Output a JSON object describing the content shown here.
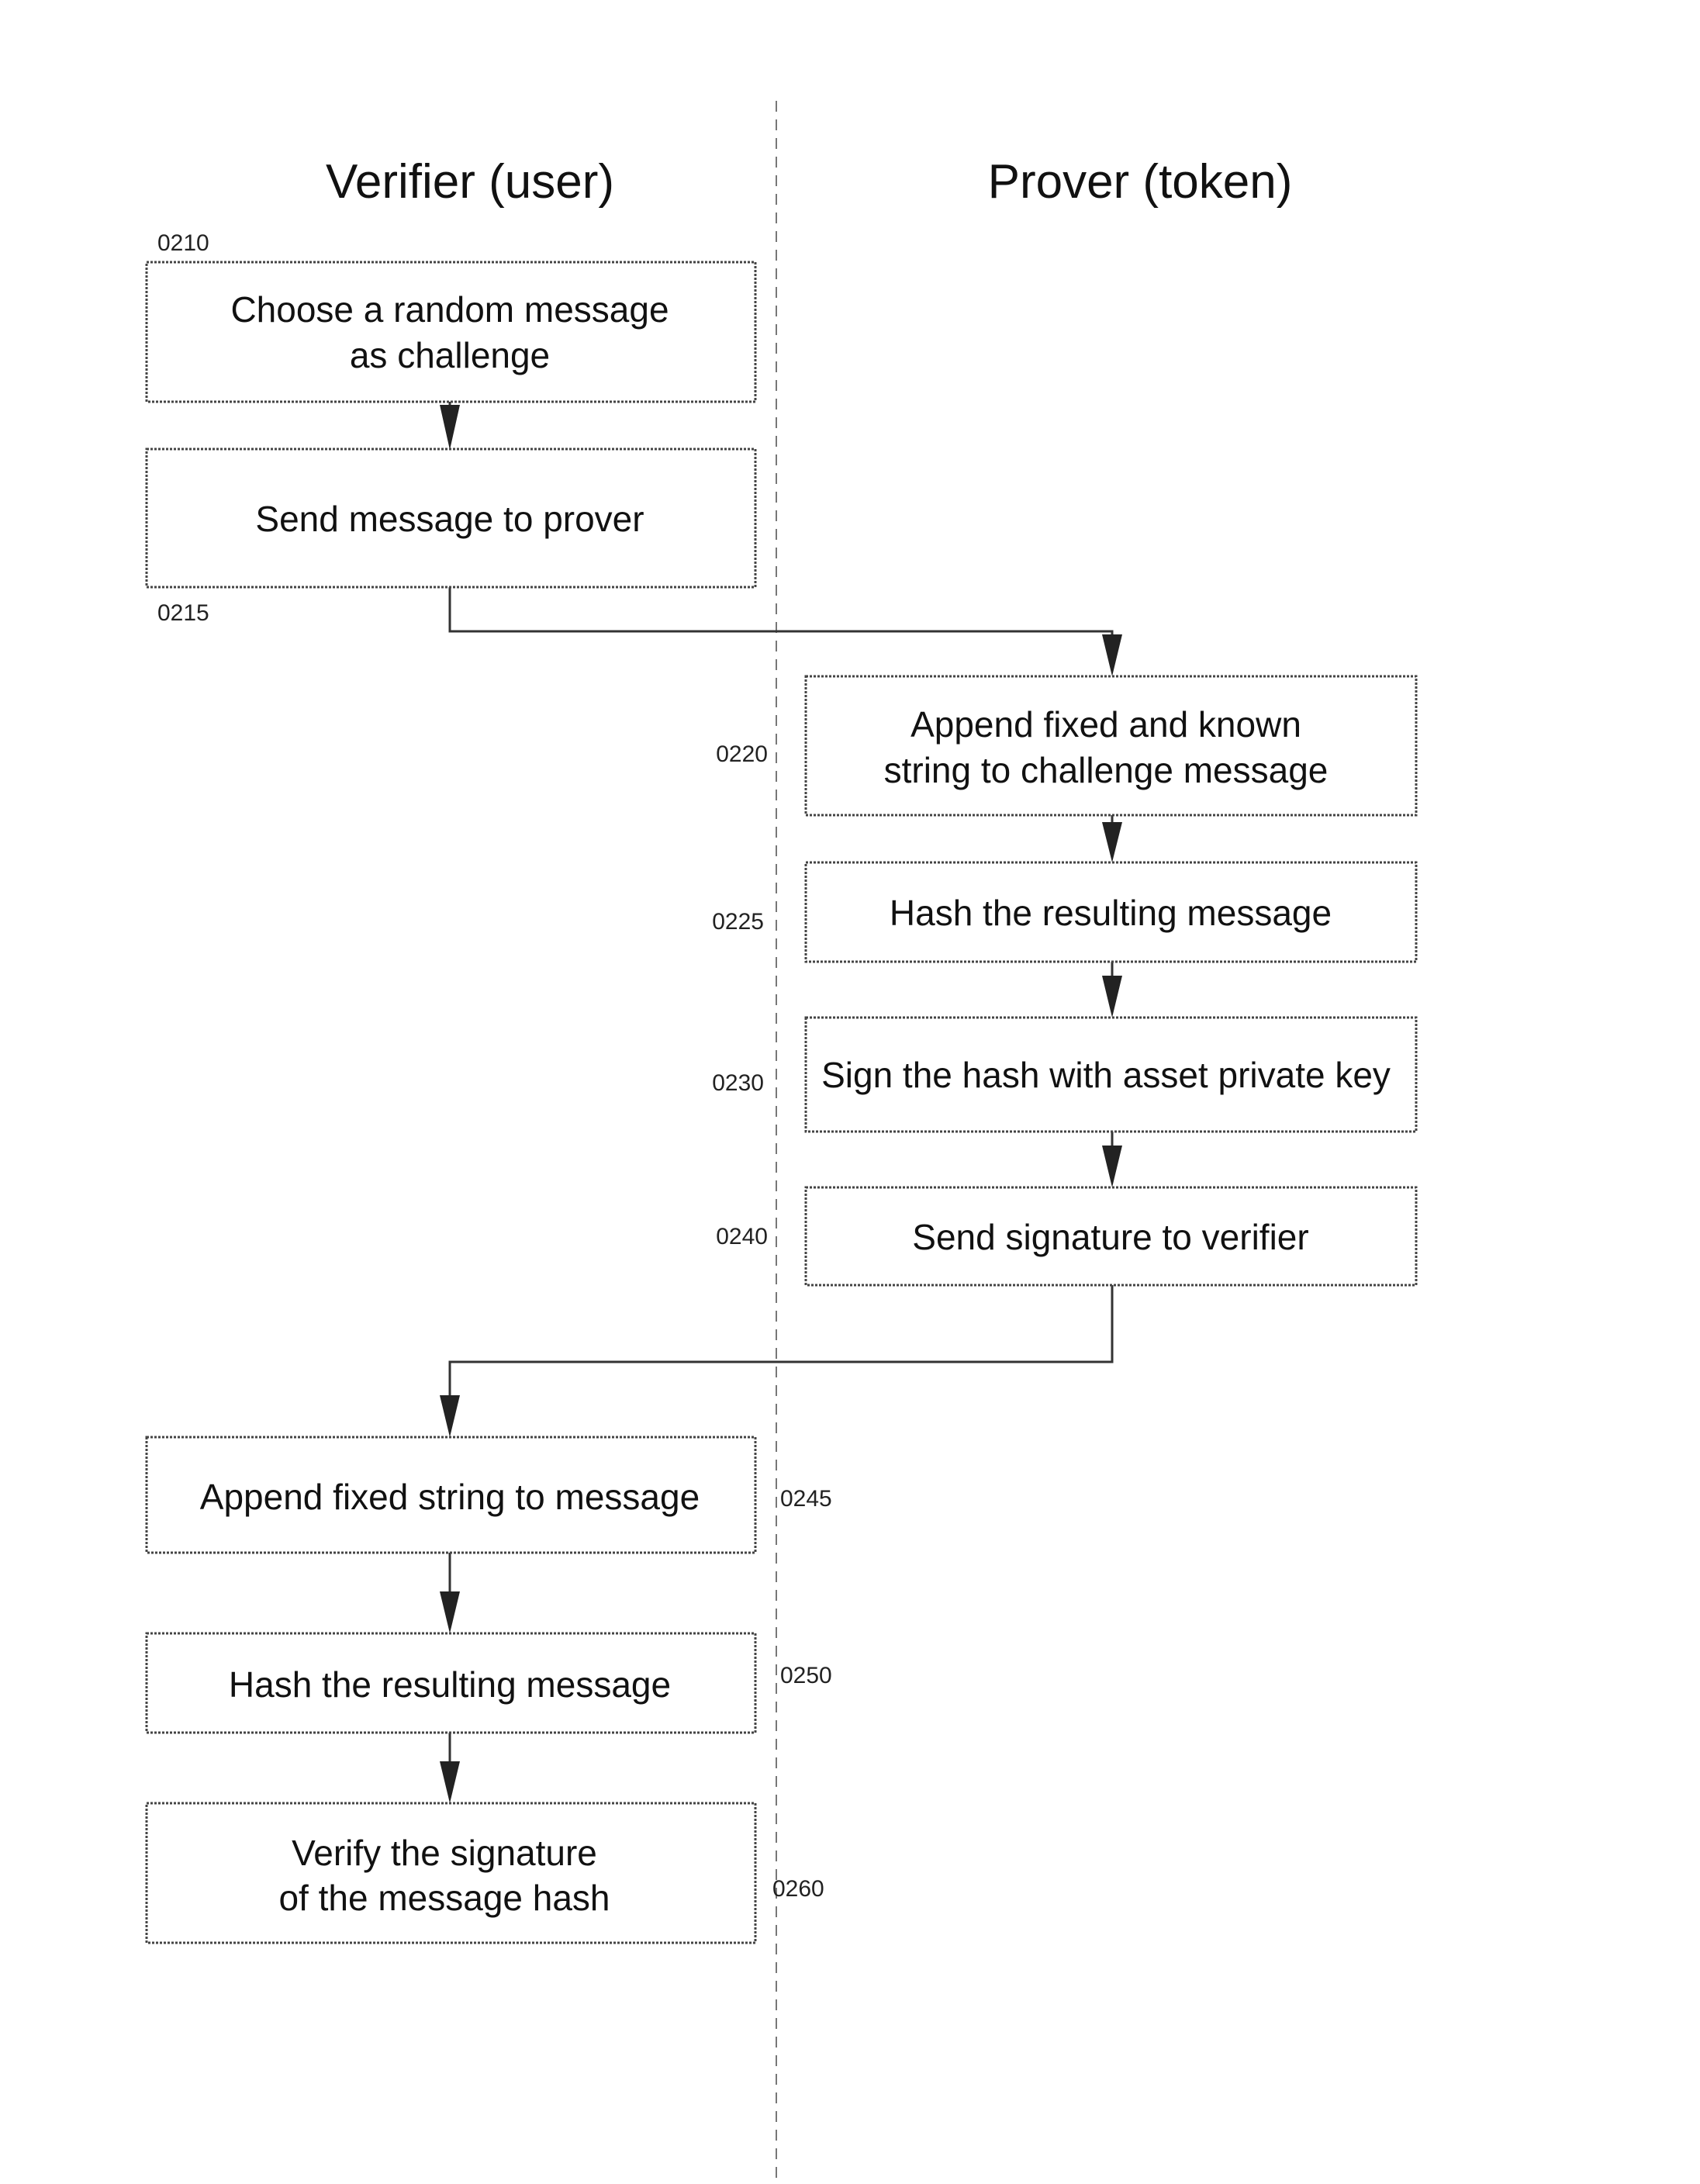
{
  "diagram": {
    "lanes": [
      {
        "id": "verifier",
        "title": "Verifier (user)"
      },
      {
        "id": "prover",
        "title": "Prover (token)"
      }
    ],
    "steps": [
      {
        "id": "0210",
        "ref": "0210",
        "lane": "verifier",
        "lines": [
          "Choose a random message",
          "as challenge"
        ]
      },
      {
        "id": "0215",
        "ref": "0215",
        "lane": "verifier",
        "lines": [
          "Send message to prover"
        ]
      },
      {
        "id": "0220",
        "ref": "0220",
        "lane": "prover",
        "lines": [
          "Append fixed and known",
          "string to challenge message"
        ]
      },
      {
        "id": "0225",
        "ref": "0225",
        "lane": "prover",
        "lines": [
          "Hash the resulting message"
        ]
      },
      {
        "id": "0230",
        "ref": "0230",
        "lane": "prover",
        "lines": [
          "Sign the hash with asset private key"
        ]
      },
      {
        "id": "0240",
        "ref": "0240",
        "lane": "prover",
        "lines": [
          "Send signature to verifier"
        ]
      },
      {
        "id": "0245",
        "ref": "0245",
        "lane": "verifier",
        "lines": [
          "Append fixed string to message"
        ]
      },
      {
        "id": "0250",
        "ref": "0250",
        "lane": "verifier",
        "lines": [
          "Hash the resulting message"
        ]
      },
      {
        "id": "0260",
        "ref": "0260",
        "lane": "verifier",
        "lines": [
          "Verify the signature",
          "of the message hash"
        ]
      }
    ],
    "edges": [
      {
        "from": "0210",
        "to": "0215"
      },
      {
        "from": "0215",
        "to": "0220"
      },
      {
        "from": "0220",
        "to": "0225"
      },
      {
        "from": "0225",
        "to": "0230"
      },
      {
        "from": "0230",
        "to": "0240"
      },
      {
        "from": "0240",
        "to": "0245"
      },
      {
        "from": "0245",
        "to": "0250"
      },
      {
        "from": "0250",
        "to": "0260"
      }
    ]
  }
}
